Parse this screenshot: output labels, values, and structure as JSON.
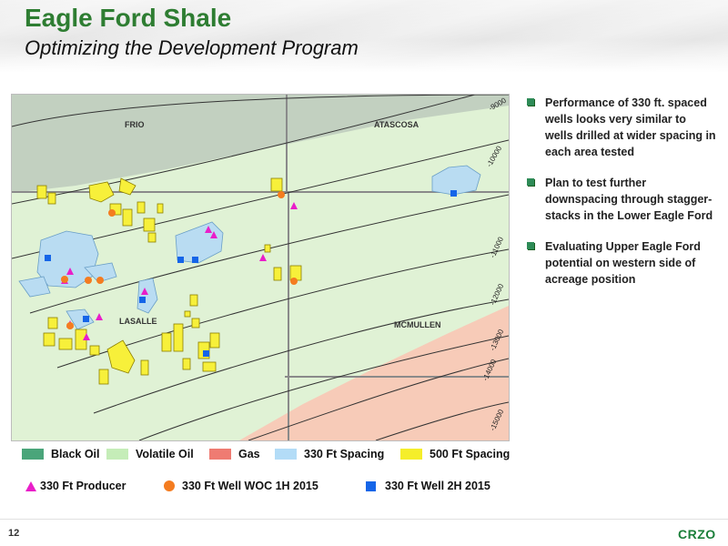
{
  "slide": {
    "title": "Eagle Ford Shale",
    "subtitle": "Optimizing the Development Program",
    "page_number": "12",
    "logo_text": "CRZO"
  },
  "map": {
    "county_labels": [
      "FRIO",
      "ATASCOSA",
      "LASALLE",
      "MCMULLEN"
    ],
    "contour_labels": [
      "-9000",
      "-10000",
      "-11000",
      "-12000",
      "-13000",
      "-14000",
      "-15000"
    ],
    "zone_colors": {
      "black_oil": "#c2d0c0",
      "volatile_oil": "#e0f2d5",
      "gas": "#f7cbb8",
      "spacing_330": "#b9dcf2",
      "spacing_500": "#f7f03a"
    }
  },
  "bullets": [
    "Performance of 330 ft. spaced wells looks very similar to wells drilled at wider spacing in each area tested",
    "Plan to test further downspacing through stagger-stacks in the Lower Eagle Ford",
    "Evaluating Upper Eagle Ford potential on western side of acreage position"
  ],
  "legend": {
    "row1": [
      {
        "label": "Black Oil",
        "color": "#4aa57a"
      },
      {
        "label": "Volatile Oil",
        "color": "#c5edb8"
      },
      {
        "label": "Gas",
        "color": "#ef7b72"
      },
      {
        "label": "330 Ft Spacing",
        "color": "#b3dcf7"
      },
      {
        "label": "500 Ft Spacing",
        "color": "#f5ee2a"
      }
    ],
    "row2": [
      {
        "label": "330 Ft Producer",
        "icon": "magenta-triangle"
      },
      {
        "label": "330 Ft Well WOC 1H 2015",
        "icon": "orange-circle"
      },
      {
        "label": "330 Ft Well 2H 2015",
        "icon": "blue-square"
      }
    ]
  }
}
